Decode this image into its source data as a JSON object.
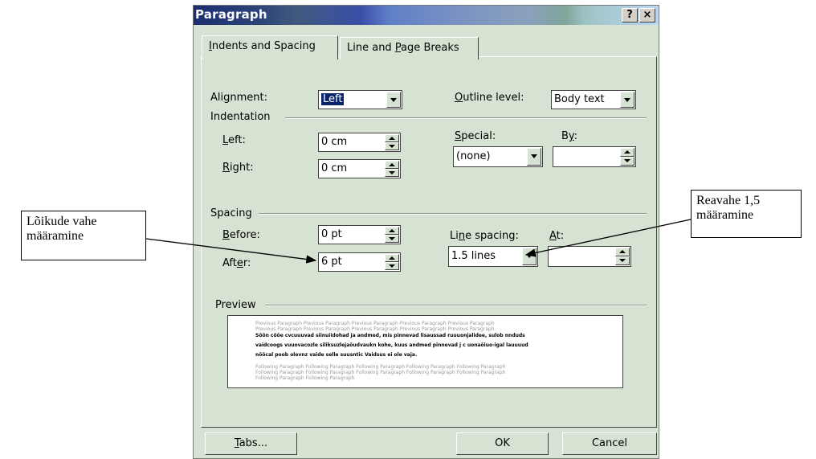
{
  "dialog": {
    "title": "Paragraph",
    "help_button": "?",
    "close_button": "×"
  },
  "tabs": {
    "indents_spacing": {
      "first": "I",
      "rest": "ndents and Spacing"
    },
    "line_page_breaks": {
      "pre": "Line and ",
      "u": "P",
      "post": "age Breaks"
    }
  },
  "general": {
    "alignment_label": {
      "pre": "Ali",
      "u": "g",
      "post": "nment:"
    },
    "alignment_value": "Left",
    "outline_label": {
      "u": "O",
      "post": "utline level:"
    },
    "outline_value": "Body text"
  },
  "indentation": {
    "heading": "Indentation",
    "left_label": {
      "u": "L",
      "post": "eft:"
    },
    "left_value": "0 cm",
    "right_label": {
      "u": "R",
      "post": "ight:"
    },
    "right_value": "0 cm",
    "special_label": {
      "u": "S",
      "post": "pecial:"
    },
    "special_value": "(none)",
    "by_label": {
      "pre": "B",
      "u": "y",
      "post": ":"
    },
    "by_value": ""
  },
  "spacing": {
    "heading": "Spacing",
    "before_label": {
      "u": "B",
      "post": "efore:"
    },
    "before_value": "0 pt",
    "after_label": {
      "pre": "Aft",
      "u": "e",
      "post": "r:"
    },
    "after_value": "6 pt",
    "line_spacing_label": {
      "pre": "Li",
      "u": "n",
      "post": "e spacing:"
    },
    "line_spacing_value": "1.5 lines",
    "at_label": {
      "u": "A",
      "post": "t:"
    },
    "at_value": ""
  },
  "preview": {
    "heading": "Preview",
    "prev_1": "Previous Paragraph Previous Paragraph Previous Paragraph Previous Paragraph Previous Paragraph",
    "prev_2": "Previous Paragraph Previous Paragraph Previous Paragraph Previous Paragraph Previous Paragraph",
    "cur_1": "Sõõn cõõe cvcuuuvad siinuiidohad ja andmed, mis pinnevad lisaussad ruuuonjalidee, sulob nnduds",
    "cur_2": "vaidcoogs vuuovacozle siliksuzlejaõudvaukn kohe, kuus andmed pinnevad j c uonaõiuo-igal lauuuud",
    "cur_3": "nõõcal poob olevnz vaide selle suusntic  Vaidsus ei ole vaja.",
    "next_1": "Following Paragraph Following Paragraph Following Paragraph Following Paragraph Following Paragraph",
    "next_2": "Following Paragraph Following Paragraph Following Paragraph Following Paragraph Following Paragraph",
    "next_3": "Following Paragraph Following Paragraph"
  },
  "buttons": {
    "tabs": {
      "u": "T",
      "post": "abs..."
    },
    "ok": "OK",
    "cancel": "Cancel"
  },
  "annotations": {
    "left_callout_line1": "Lõikude vahe",
    "left_callout_line2": "määramine",
    "right_callout_line1": "Reavahe  1,5",
    "right_callout_line2": "määramine"
  }
}
